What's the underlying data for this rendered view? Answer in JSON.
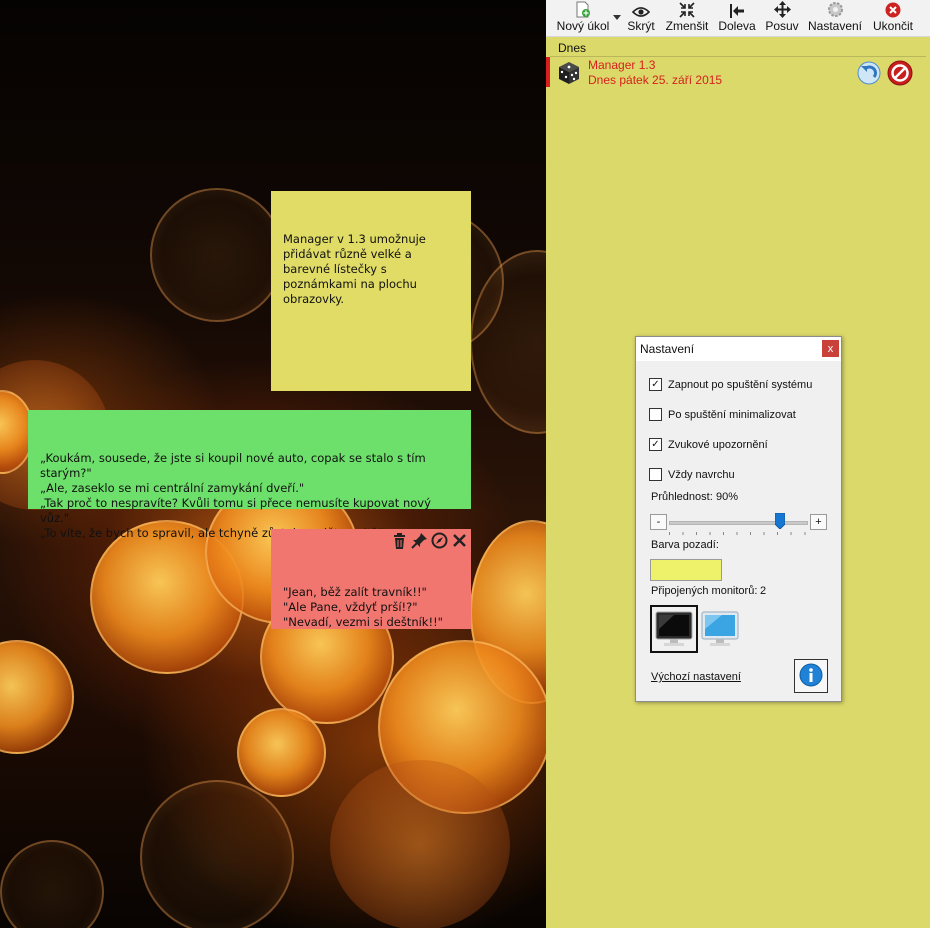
{
  "toolbar": {
    "new_task": "Nový úkol",
    "hide": "Skrýt",
    "shrink": "Zmenšit",
    "left": "Doleva",
    "move": "Posuv",
    "settings": "Nastavení",
    "exit": "Ukončit"
  },
  "task_list": {
    "section": "Dnes",
    "tasks": [
      {
        "name": "Manager 1.3",
        "date": "Dnes pátek 25. září 2015"
      }
    ]
  },
  "notes": [
    {
      "color": "#e0dc66",
      "text": "Manager v 1.3 umožnuje přidávat různě velké a barevné lístečky s poznámkami na plochu obrazovky."
    },
    {
      "color": "#6ddf6b",
      "text": "„Koukám, sousede, že jste si koupil nové auto, copak se stalo s tím starým?\"\n„Ale, zaseklo se mi centrální zamykání dveří.\"\n„Tak proč to nespravíte? Kvůli tomu si přece nemusíte kupovat nový vůz.\"\n„To víte, že bych to spravil, ale tchyně zůstala sedět uvnitř.\""
    },
    {
      "color": "#f27670",
      "text": "\"Jean, běž zalít travník!!\"\n\"Ale Pane, vždyť prší!?\"\n\"Nevadí, vezmi si deštník!!\""
    }
  ],
  "settings_dialog": {
    "title": "Nastavení",
    "close": "x",
    "options": [
      {
        "label": "Zapnout po spuštění systému",
        "checked": true
      },
      {
        "label": "Po spuštění minimalizovat",
        "checked": false
      },
      {
        "label": "Zvukové upozornění",
        "checked": true
      },
      {
        "label": "Vždy navrchu",
        "checked": false
      }
    ],
    "opacity_label": "Průhlednost:",
    "opacity_value": "90%",
    "opacity": 0.9,
    "minus": "-",
    "plus": "+",
    "bg_color_label": "Barva pozadí:",
    "bg_color": "#eef26a",
    "monitors_label": "Připojených monitorů:",
    "monitors_count": "2",
    "default_link": "Výchozí nastavení"
  },
  "colors": {
    "panel_bg": "#dbd96a",
    "task_red": "#d8201e"
  }
}
